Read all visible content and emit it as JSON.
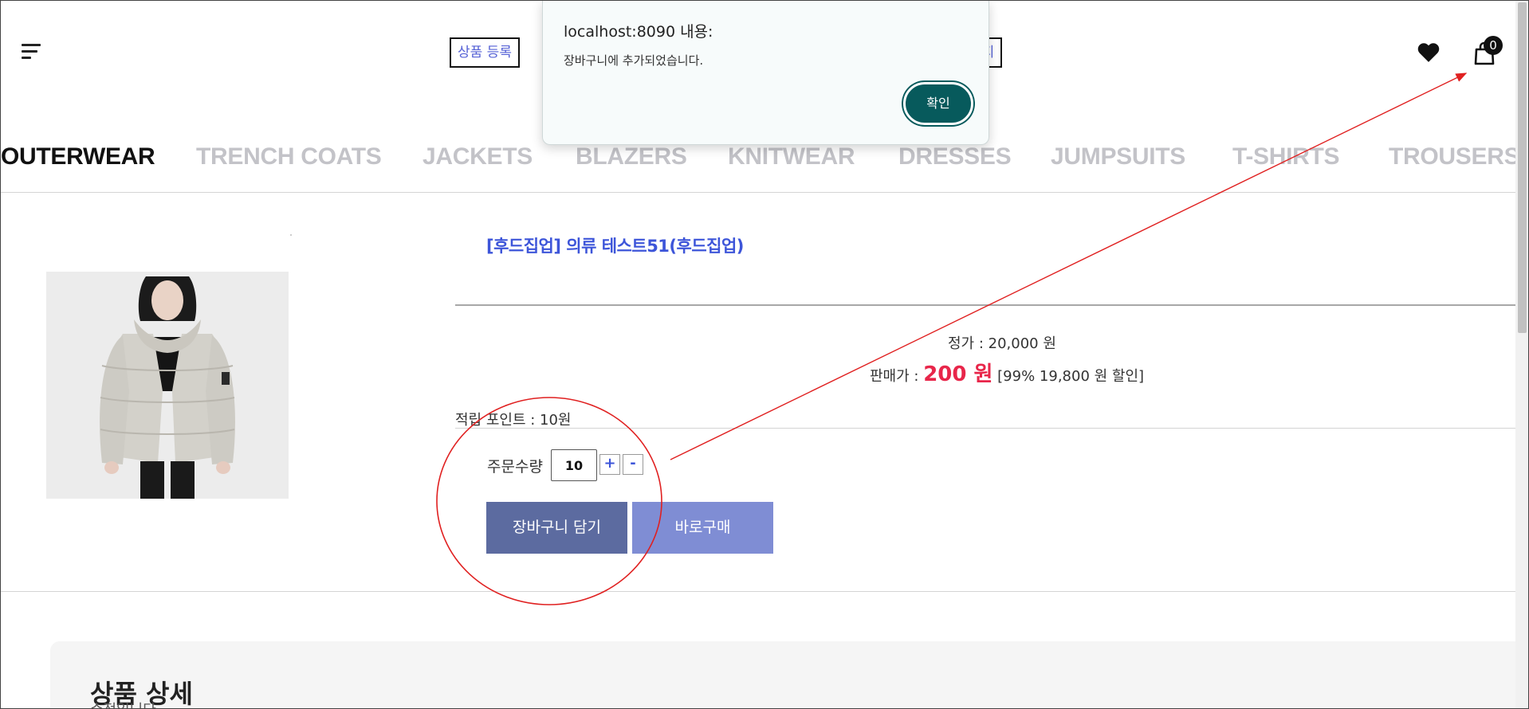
{
  "header": {
    "register_link": "상품 등록",
    "mypage_link": "이지",
    "cart_count": "0"
  },
  "categories": [
    {
      "label": "OUTERWEAR",
      "active": true
    },
    {
      "label": "TRENCH COATS",
      "active": false
    },
    {
      "label": "JACKETS",
      "active": false
    },
    {
      "label": "BLAZERS",
      "active": false
    },
    {
      "label": "KNITWEAR",
      "active": false
    },
    {
      "label": "DRESSES",
      "active": false
    },
    {
      "label": "JUMPSUITS",
      "active": false
    },
    {
      "label": "T-SHIRTS",
      "active": false
    },
    {
      "label": "TROUSERS",
      "active": false
    }
  ],
  "product": {
    "title": "[후드집업] 의류 테스트51(후드집업)",
    "list_price_label": "정가 : ",
    "list_price_value": "20,000 원",
    "sale_price_label": "판매가 : ",
    "sale_price_value": "200 원",
    "discount_text": " [99% 19,800 원 할인]",
    "points_text": "적립 포인트 : 10원",
    "quantity_label": "주문수량",
    "quantity_value": "10",
    "plus_label": "+",
    "minus_label": "-",
    "add_to_cart_label": "장바구니 담기",
    "buy_now_label": "바로구매"
  },
  "detail": {
    "title": "상품 상세",
    "subtitle": "수정입니다"
  },
  "alert": {
    "title": "localhost:8090 내용:",
    "message": "장바구니에 추가되었습니다.",
    "ok_label": "확인"
  },
  "colors": {
    "accent_blue": "#3d55d9",
    "sale_red": "#e8264a",
    "cart_button": "#5c6ba0",
    "buy_button": "#7f8dd4",
    "alert_button": "#075a5c",
    "annotation_red": "#e02020"
  }
}
